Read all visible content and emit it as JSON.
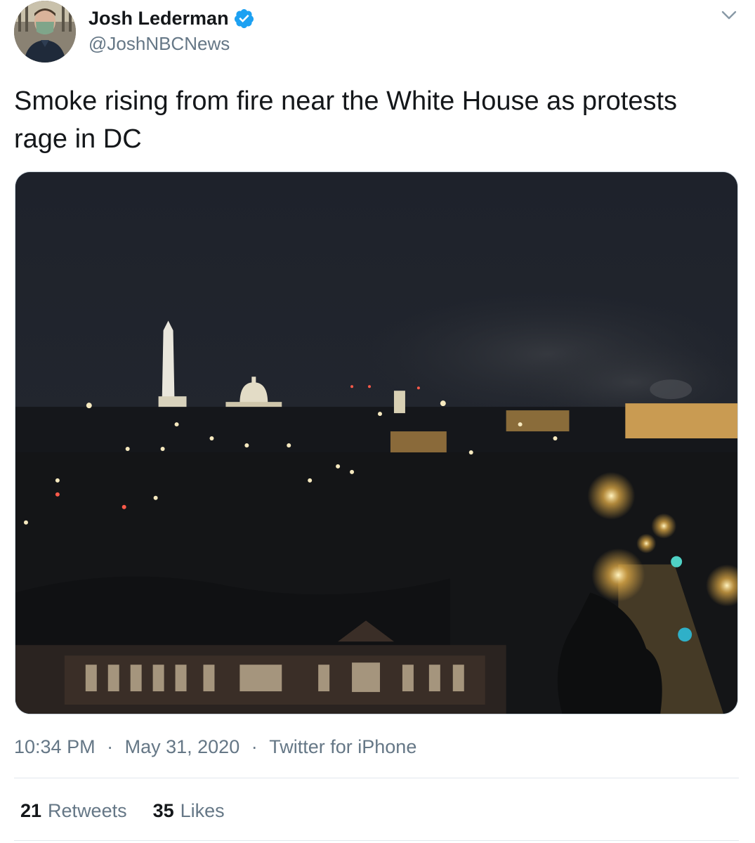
{
  "author": {
    "display_name": "Josh Lederman",
    "handle": "@JoshNBCNews",
    "verified": true
  },
  "tweet": {
    "text": "Smoke rising from fire near the White House as protests rage in DC",
    "time": "10:34 PM",
    "date": "May 31, 2020",
    "source": "Twitter for iPhone",
    "separator": "·"
  },
  "stats": {
    "retweets_count": "21",
    "retweets_label": "Retweets",
    "likes_count": "35",
    "likes_label": "Likes"
  },
  "icons": {
    "verified": "verified-badge-icon",
    "menu": "chevron-down-icon"
  },
  "colors": {
    "verified_blue": "#1da1f2",
    "secondary_text": "#657786",
    "primary_text": "#14171a",
    "divider": "#e1e8ed"
  }
}
